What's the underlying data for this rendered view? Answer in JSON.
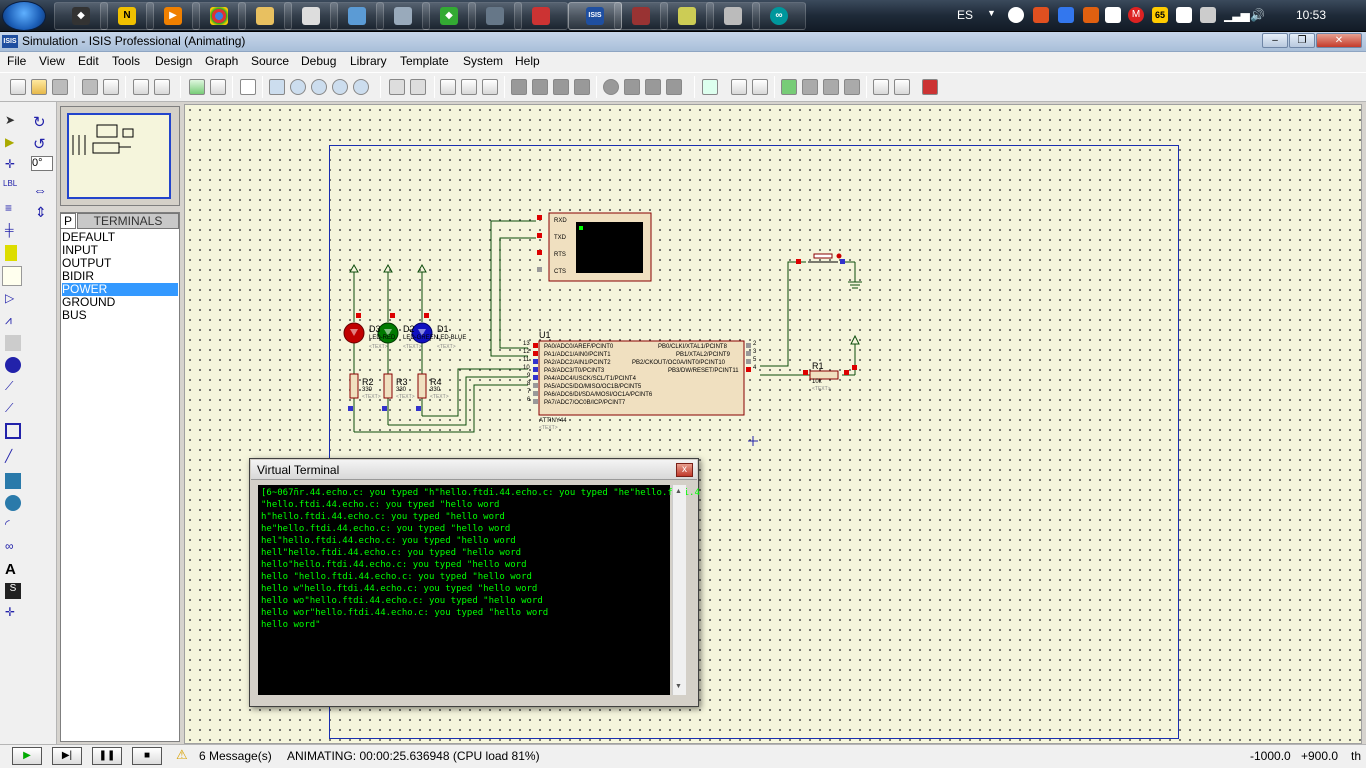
{
  "taskbar": {
    "language": "ES",
    "clock": "10:53",
    "badge_number": "65",
    "badge_m": "M"
  },
  "window": {
    "app_icon_text": "ISIS",
    "title": "Simulation - ISIS Professional (Animating)"
  },
  "menu": [
    "File",
    "View",
    "Edit",
    "Tools",
    "Design",
    "Graph",
    "Source",
    "Debug",
    "Library",
    "Template",
    "System",
    "Help"
  ],
  "lefttools": {
    "rotation_value": "0°"
  },
  "terminals": {
    "p_button": "P",
    "header": "TERMINALS",
    "items": [
      "DEFAULT",
      "INPUT",
      "OUTPUT",
      "BIDIR",
      "POWER",
      "GROUND",
      "BUS"
    ],
    "selected": "POWER"
  },
  "schematic": {
    "leds": [
      {
        "ref": "D3",
        "label": "LED-RED",
        "text": "<TEXT>",
        "color": "#c00000"
      },
      {
        "ref": "D2",
        "label": "LED-GREEN",
        "text": "<TEXT>",
        "color": "#007a00"
      },
      {
        "ref": "D1",
        "label": "LED-BLUE",
        "text": "<TEXT>",
        "color": "#1010c0"
      }
    ],
    "resistors": [
      {
        "ref": "R2",
        "value": "330",
        "text": "<TEXT>"
      },
      {
        "ref": "R3",
        "value": "330",
        "text": "<TEXT>"
      },
      {
        "ref": "R4",
        "value": "330",
        "text": "<TEXT>"
      },
      {
        "ref": "R1",
        "value": "10k",
        "text": "<TEXT>"
      }
    ],
    "chip": {
      "ref": "U1",
      "part": "ATTINY44",
      "text": "<TEXT>",
      "left_pins": [
        "PA0/ADC0/AREF/PCINT0",
        "PA1/ADC1/AIN0/PCINT1",
        "PA2/ADC2/AIN1/PCINT2",
        "PA3/ADC3/T0/PCINT3",
        "PA4/ADC4/USCK/SCL/T1/PCINT4",
        "PA5/ADC5/DO/MISO/OC1B/PCINT5",
        "PA6/ADC6/DI/SDA/MOSI/OC1A/PCINT6",
        "PA7/ADC7/OC0B/ICP/PCINT7"
      ],
      "left_nums": [
        "13",
        "12",
        "11",
        "10",
        "9",
        "8",
        "7",
        "6"
      ],
      "right_pins": [
        "PB0/CLKI/XTAL1/PCINT8",
        "PB1/XTAL2/PCINT9",
        "PB2/CKOUT/OC0A/INT0/PCINT10",
        "PB3/DW/RESET/PCINT11"
      ],
      "right_nums": [
        "2",
        "3",
        "5",
        "4"
      ]
    },
    "terminal_component": {
      "pins": [
        "RXD",
        "TXD",
        "RTS",
        "CTS"
      ]
    }
  },
  "virtual_terminal": {
    "title": "Virtual Terminal",
    "close_label": "x",
    "lines": [
      "[6~067ñr.44.echo.c: you typed \"h\"hello.ftdi.44.echo.c: you typed \"he\"hello.ftdi.4",
      "\"hello.ftdi.44.echo.c: you typed \"hello word",
      "h\"hello.ftdi.44.echo.c: you typed \"hello word",
      "he\"hello.ftdi.44.echo.c: you typed \"hello word",
      "hel\"hello.ftdi.44.echo.c: you typed \"hello word",
      "hell\"hello.ftdi.44.echo.c: you typed \"hello word",
      "hello\"hello.ftdi.44.echo.c: you typed \"hello word",
      "hello \"hello.ftdi.44.echo.c: you typed \"hello word",
      "hello w\"hello.ftdi.44.echo.c: you typed \"hello word",
      "hello wo\"hello.ftdi.44.echo.c: you typed \"hello word",
      "hello wor\"hello.ftdi.44.echo.c: you typed \"hello word",
      "hello word\""
    ]
  },
  "status": {
    "messages": "6 Message(s)",
    "animating": "ANIMATING: 00:00:25.636948 (CPU load 81%)",
    "coord_x": "-1000.0",
    "coord_y": "+900.0",
    "unit": "th"
  },
  "colors": {
    "sheet_border": "#1a2fb0",
    "terminal_text": "#00ff00",
    "selected_bg": "#3399ff",
    "wire": "#0a4a0a"
  }
}
